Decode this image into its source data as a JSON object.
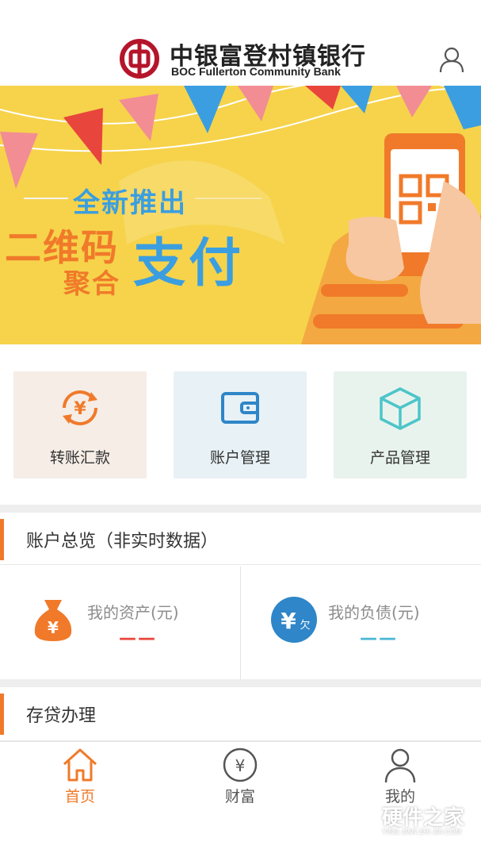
{
  "header": {
    "bank_name_cn": "中银富登村镇银行",
    "bank_name_en": "BOC Fullerton Community Bank",
    "logo_icon": "boc-logo-icon",
    "user_icon": "user-icon"
  },
  "banner": {
    "subtitle": "全新推出",
    "title_part1": "二维码",
    "title_part2": "聚合",
    "title_part3": "支付",
    "phone_icon": "qr-code-phone-icon"
  },
  "quick_actions": [
    {
      "label": "转账汇款",
      "icon": "yen-transfer-icon",
      "color": "#f07a2a"
    },
    {
      "label": "账户管理",
      "icon": "wallet-icon",
      "color": "#2f86c8"
    },
    {
      "label": "产品管理",
      "icon": "cube-icon",
      "color": "#4cc5c8"
    }
  ],
  "overview": {
    "title": "账户总览（非实时数据）",
    "assets": {
      "label": "我的资产(元)",
      "value": "——",
      "icon": "money-bag-icon",
      "color": "#f07a2a"
    },
    "liabilities": {
      "label": "我的负债(元)",
      "value": "——",
      "icon": "yen-debt-icon",
      "color": "#2f86c8",
      "badge": "欠"
    }
  },
  "deposit_loan": {
    "title": "存贷办理"
  },
  "tabbar": {
    "items": [
      {
        "label": "首页",
        "icon": "home-icon",
        "active": true
      },
      {
        "label": "财富",
        "icon": "yen-circle-icon",
        "active": false
      },
      {
        "label": "我的",
        "icon": "profile-icon",
        "active": false
      }
    ],
    "active_color": "#f07a2a",
    "inactive_color": "#555555"
  },
  "watermark": {
    "cn": "硬件之家",
    "en": "YING JIAN ZHI JIA.COM"
  }
}
